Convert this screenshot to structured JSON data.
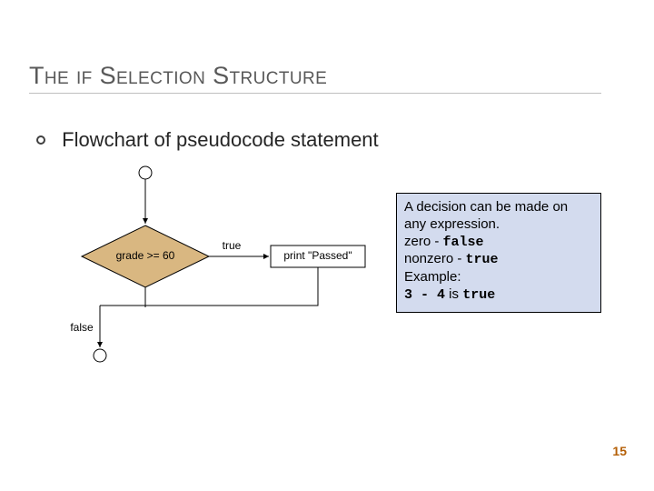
{
  "title": "The if Selection Structure",
  "bullet": "Flowchart of pseudocode statement",
  "flow": {
    "condition": "grade >= 60",
    "true_label": "true",
    "false_label": "false",
    "action": "print \"Passed\""
  },
  "info": {
    "line1": "A decision can be made on any expression.",
    "zero_word": "zero - ",
    "zero_code": "false",
    "nonzero_word": "nonzero - ",
    "nonzero_code": "true",
    "example_label": "Example:",
    "example_expr": "3 - 4",
    "example_tail": " is ",
    "example_code": "true"
  },
  "page_number": "15"
}
